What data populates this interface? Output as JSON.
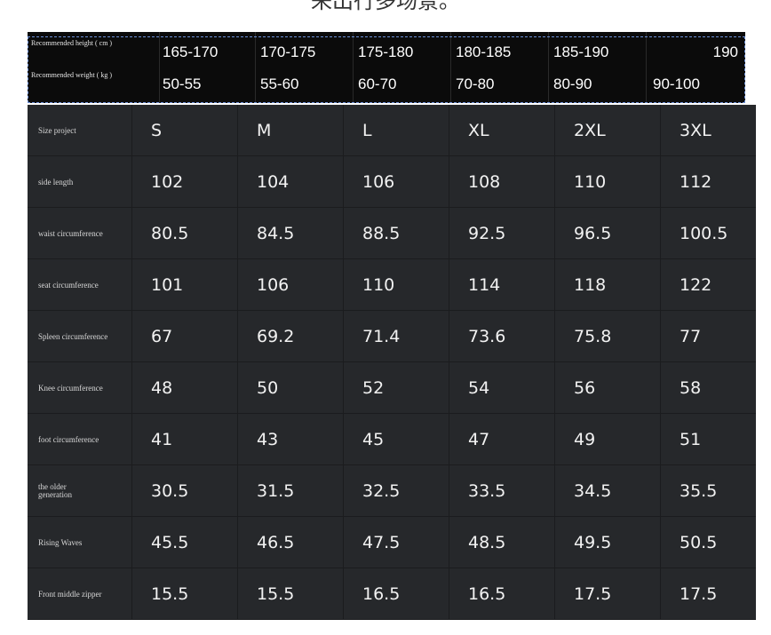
{
  "caption": "来出行多场景。",
  "recommendation": {
    "height_label": "Recommended height ( cm )",
    "weight_label": "Recommended weight ( kg )",
    "heights": [
      "165-170",
      "170-175",
      "175-180",
      "180-185",
      "185-190",
      "190"
    ],
    "weights": [
      "50-55",
      "55-60",
      "60-70",
      "70-80",
      "80-90",
      "90-100"
    ]
  },
  "size_table": {
    "rows": [
      {
        "label": "Size project",
        "values": [
          "S",
          "M",
          "L",
          "XL",
          "2XL",
          "3XL"
        ]
      },
      {
        "label": "side length",
        "values": [
          "102",
          "104",
          "106",
          "108",
          "110",
          "112"
        ]
      },
      {
        "label": "waist circumference",
        "values": [
          "80.5",
          "84.5",
          "88.5",
          "92.5",
          "96.5",
          "100.5"
        ]
      },
      {
        "label": "seat circumference",
        "values": [
          "101",
          "106",
          "110",
          "114",
          "118",
          "122"
        ]
      },
      {
        "label": "Spleen circumference",
        "values": [
          "67",
          "69.2",
          "71.4",
          "73.6",
          "75.8",
          "77"
        ]
      },
      {
        "label": "Knee circumference",
        "values": [
          "48",
          "50",
          "52",
          "54",
          "56",
          "58"
        ]
      },
      {
        "label": "foot circumference",
        "values": [
          "41",
          "43",
          "45",
          "47",
          "49",
          "51"
        ]
      },
      {
        "label": "the older generation",
        "values": [
          "30.5",
          "31.5",
          "32.5",
          "33.5",
          "34.5",
          "35.5"
        ]
      },
      {
        "label": "Rising Waves",
        "values": [
          "45.5",
          "46.5",
          "47.5",
          "48.5",
          "49.5",
          "50.5"
        ]
      },
      {
        "label": "Front middle zipper",
        "values": [
          "15.5",
          "15.5",
          "16.5",
          "16.5",
          "17.5",
          "17.5"
        ]
      }
    ]
  }
}
